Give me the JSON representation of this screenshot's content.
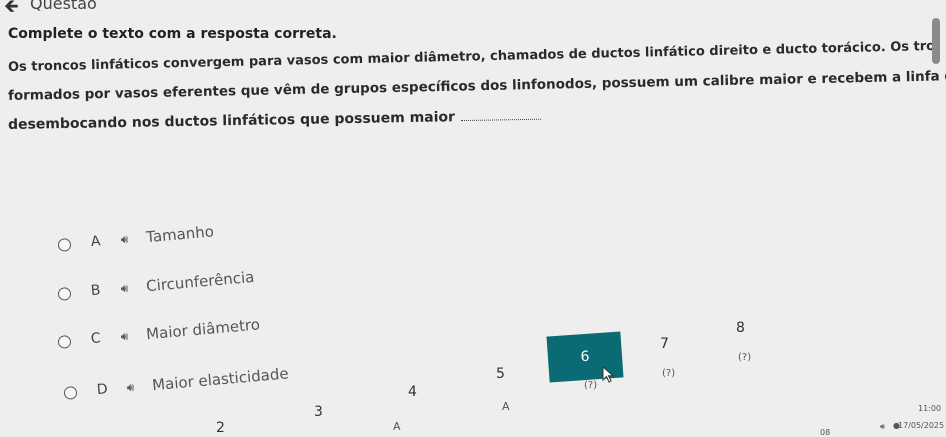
{
  "header": {
    "back_icon": "arrow-left-icon",
    "title": "Questão"
  },
  "question": {
    "instruction": "Complete o texto com  a resposta correta.",
    "line1": "Os troncos linfáticos convergem para vasos com maior diâmetro, chamados de ductos linfático direito e ducto torácico. Os troncos linfáticos são",
    "line2": "formados por vasos eferentes que vêm de grupos específicos dos linfonodos, possuem um calibre maior e recebem a linfa de grupos de coletores,",
    "line3": "desembocando nos ductos linfáticos que possuem maior"
  },
  "options": [
    {
      "letter": "A",
      "text": "Tamanho",
      "icon": "speaker-icon"
    },
    {
      "letter": "B",
      "text": "Circunferência",
      "icon": "speaker-icon"
    },
    {
      "letter": "C",
      "text": "Maior diâmetro",
      "icon": "speaker-icon"
    },
    {
      "letter": "D",
      "text": "Maior elasticidade",
      "icon": "speaker-icon"
    }
  ],
  "navigation": {
    "numbers": [
      "2",
      "3",
      "4",
      "5",
      "6",
      "7",
      "8"
    ],
    "current": "6",
    "answers": [
      "A",
      "A",
      "(?)",
      "(?)",
      "(?)"
    ]
  },
  "taskbar": {
    "time": "11:00",
    "date": "17/05/2025",
    "partial": "08"
  }
}
